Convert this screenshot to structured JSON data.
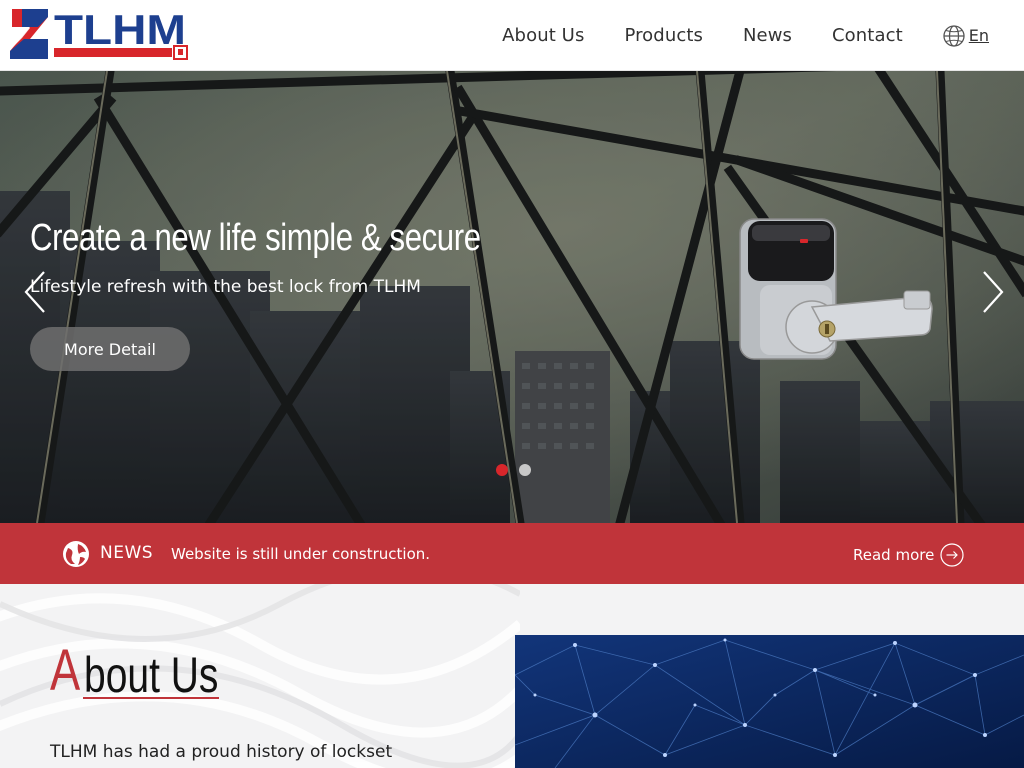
{
  "header": {
    "logo_text": "TLHM",
    "nav": [
      "About Us",
      "Products",
      "News",
      "Contact"
    ],
    "lang_label": "En",
    "lang_icon": "globe-icon"
  },
  "hero": {
    "title": "Create a new life simple & secure",
    "subtitle": "Lifestyle refresh with the best lock from TLHM",
    "button_label": "More Detail",
    "prev_icon": "chevron-left-icon",
    "next_icon": "chevron-right-icon",
    "slides_count": 2,
    "active_slide": 1
  },
  "news": {
    "label": "NEWS",
    "text": "Website is still under construction.",
    "read_more": "Read more",
    "icon": "news-globe-icon",
    "read_more_icon": "arrow-circle-icon"
  },
  "about": {
    "title_initial": "A",
    "title_rest": "bout Us",
    "text": "TLHM has had a proud history of lockset"
  },
  "colors": {
    "brand_red": "#c0343a",
    "brand_blue": "#1d3f8f",
    "dot_active": "#d8262b",
    "dot_inactive": "#c8c8c8"
  }
}
